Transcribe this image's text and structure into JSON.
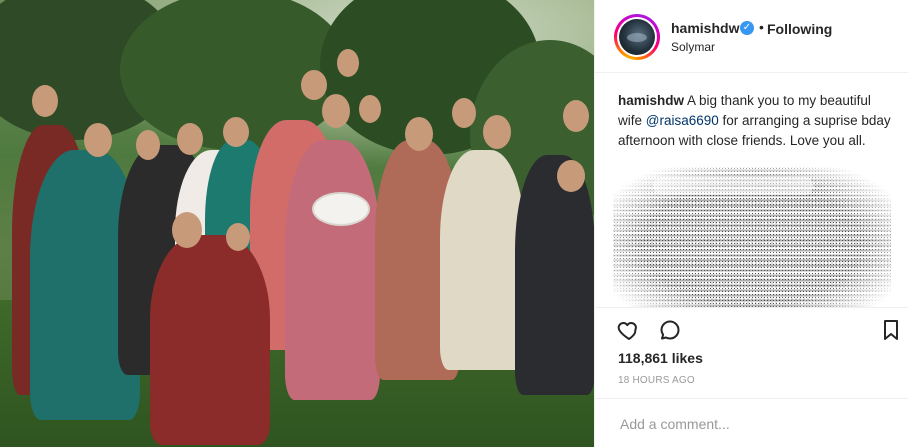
{
  "post": {
    "image": {
      "icon": "photo",
      "alt": ""
    },
    "author": {
      "username": "hamishdw",
      "verified": true,
      "follow_separator": "•",
      "follow_status": "Following",
      "location": "Solymar"
    },
    "caption": {
      "username": "hamishdw",
      "text_before_mention": "A big thank you to my beautiful wife ",
      "mention": "@raisa6690",
      "text_after_mention": " for arranging a suprise bday afternoon with close friends. Love you all."
    },
    "actions": {
      "like_icon": "heart-icon",
      "comment_icon": "comment-icon",
      "save_icon": "bookmark-icon"
    },
    "likes_text": "118,861 likes",
    "timestamp": "18 HOURS AGO",
    "add_comment_placeholder": "Add a comment..."
  },
  "colors": {
    "text": "#262626",
    "muted": "#999999",
    "link": "#003569",
    "verified": "#3897f0",
    "border": "#efefef"
  }
}
